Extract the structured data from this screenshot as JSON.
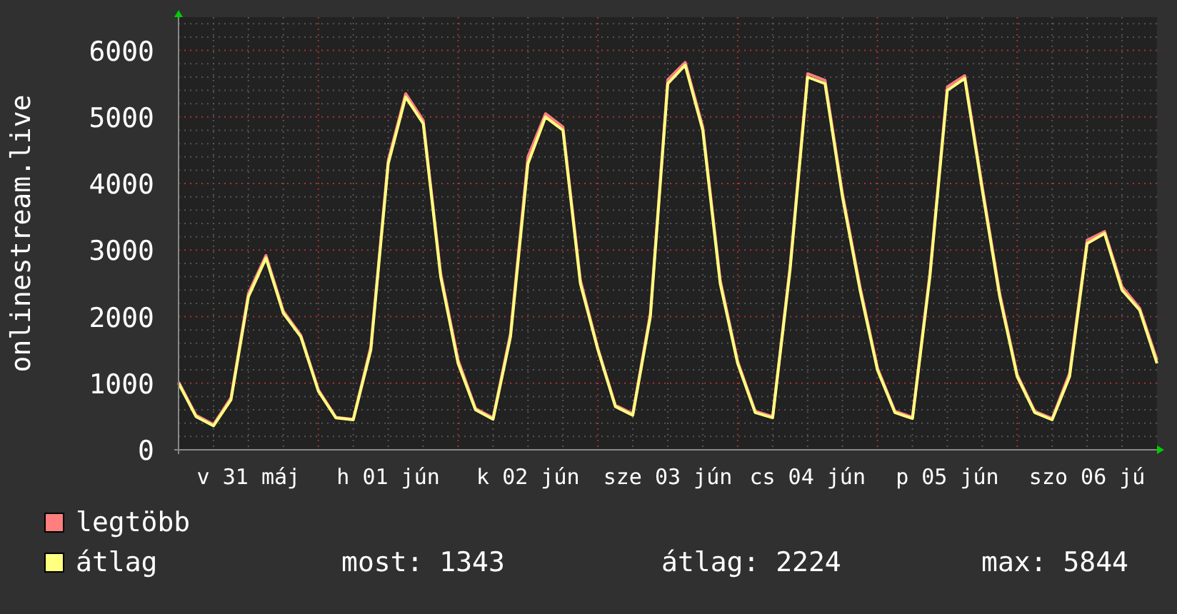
{
  "chart": {
    "chart_data": {
      "type": "line",
      "ylabel": "onlinestream.live",
      "categories": [
        null,
        null,
        null,
        null,
        "v 31 máj",
        null,
        null,
        null,
        null,
        null,
        null,
        null,
        "h 01 jún",
        null,
        null,
        null,
        null,
        null,
        null,
        null,
        "k 02 jún",
        null,
        null,
        null,
        null,
        null,
        null,
        null,
        "sze 03 jún",
        null,
        null,
        null,
        null,
        null,
        null,
        null,
        "cs 04 jún",
        null,
        null,
        null,
        null,
        null,
        null,
        null,
        "p 05 jún",
        null,
        null,
        null,
        null,
        null,
        null,
        null,
        "szo 06 jú",
        null,
        null,
        null,
        null
      ],
      "grid": true,
      "ylim": [
        0,
        6500
      ],
      "yticks": [
        0,
        1000,
        2000,
        3000,
        4000,
        5000,
        6000
      ],
      "series": [
        {
          "name": "legtöbb",
          "color": "#ff7f7f",
          "values": [
            1020,
            520,
            380,
            780,
            2350,
            2920,
            2080,
            1720,
            900,
            490,
            460,
            1550,
            4350,
            5350,
            4950,
            2650,
            1350,
            620,
            480,
            1750,
            4400,
            5050,
            4850,
            2550,
            1520,
            670,
            540,
            2050,
            5560,
            5820,
            4850,
            2550,
            1330,
            580,
            500,
            2750,
            5650,
            5550,
            3850,
            2450,
            1230,
            580,
            490,
            2650,
            5450,
            5620,
            3950,
            2350,
            1130,
            580,
            470,
            1150,
            3150,
            3280,
            2450,
            2130,
            1350
          ]
        },
        {
          "name": "átlag",
          "color": "#ffff80",
          "values": [
            1000,
            500,
            360,
            750,
            2300,
            2880,
            2050,
            1700,
            880,
            480,
            450,
            1500,
            4300,
            5300,
            4900,
            2600,
            1300,
            600,
            460,
            1700,
            4300,
            5000,
            4800,
            2500,
            1500,
            650,
            520,
            2000,
            5500,
            5780,
            4800,
            2500,
            1300,
            560,
            480,
            2700,
            5600,
            5500,
            3800,
            2400,
            1200,
            560,
            470,
            2600,
            5400,
            5580,
            3900,
            2300,
            1100,
            560,
            450,
            1100,
            3100,
            3250,
            2400,
            2100,
            1300
          ]
        }
      ]
    }
  },
  "legend_stats": [
    "most: 1343",
    "átlag: 2224",
    "max: 5844"
  ]
}
